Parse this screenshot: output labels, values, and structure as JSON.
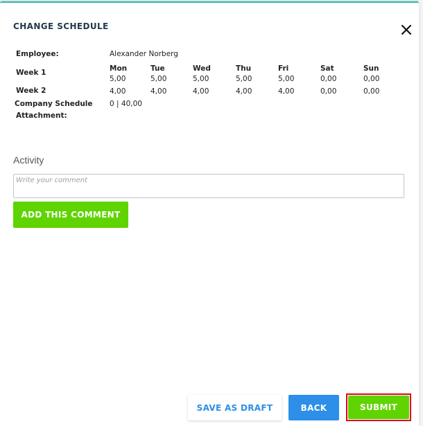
{
  "dialog": {
    "title": "CHANGE SCHEDULE"
  },
  "employee": {
    "label": "Employee:",
    "value": "Alexander Norberg"
  },
  "schedule": {
    "days": [
      "Mon",
      "Tue",
      "Wed",
      "Thu",
      "Fri",
      "Sat",
      "Sun"
    ],
    "weeks": [
      {
        "label": "Week 1",
        "values": [
          "5,00",
          "5,00",
          "5,00",
          "5,00",
          "5,00",
          "0,00",
          "0,00"
        ]
      },
      {
        "label": "Week 2",
        "values": [
          "4,00",
          "4,00",
          "4,00",
          "4,00",
          "4,00",
          "0,00",
          "0,00"
        ]
      }
    ]
  },
  "company_schedule": {
    "label": "Company Schedule",
    "value": "0 | 40,00"
  },
  "attachment": {
    "label": "Attachment:"
  },
  "activity": {
    "heading": "Activity",
    "comment_placeholder": "Write your comment",
    "add_comment_label": "ADD THIS COMMENT"
  },
  "footer": {
    "save_draft_label": "SAVE AS DRAFT",
    "back_label": "BACK",
    "submit_label": "SUBMIT"
  },
  "colors": {
    "accent_green": "#5fd400",
    "accent_blue": "#2d8fe8",
    "title_color": "#23394d",
    "highlight_red": "#e3001b"
  },
  "icons": {
    "close": "close-icon"
  }
}
